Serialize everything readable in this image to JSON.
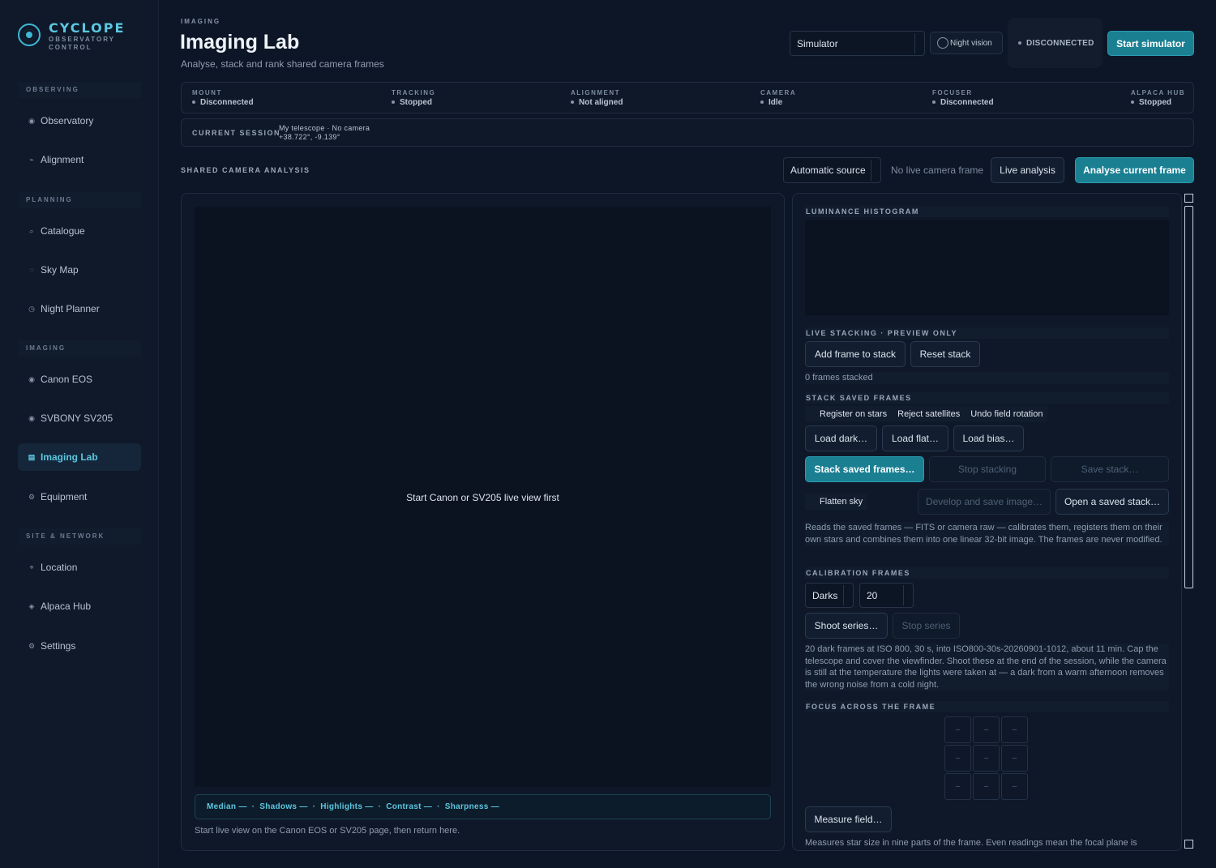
{
  "brand": {
    "name": "CYCLOPE",
    "sub1": "OBSERVATORY",
    "sub2": "CONTROL"
  },
  "sidebar": {
    "sections": [
      {
        "title": "OBSERVING"
      },
      {
        "title": "PLANNING"
      },
      {
        "title": "IMAGING"
      },
      {
        "title": "SITE & NETWORK"
      }
    ],
    "items": [
      {
        "label": "Observatory",
        "icon": "◉"
      },
      {
        "label": "Alignment",
        "icon": "⌁"
      },
      {
        "label": "Catalogue",
        "icon": "⌕"
      },
      {
        "label": "Sky Map",
        "icon": "◌"
      },
      {
        "label": "Night Planner",
        "icon": "◷"
      },
      {
        "label": "Canon EOS",
        "icon": "◉"
      },
      {
        "label": "SVBONY SV205",
        "icon": "◉"
      },
      {
        "label": "Imaging Lab",
        "icon": "▤"
      },
      {
        "label": "Equipment",
        "icon": "⚙"
      },
      {
        "label": "Location",
        "icon": "⌖"
      },
      {
        "label": "Alpaca Hub",
        "icon": "◈"
      },
      {
        "label": "Settings",
        "icon": "⚙"
      }
    ]
  },
  "header": {
    "eyebrow": "IMAGING",
    "title": "Imaging Lab",
    "subtitle": "Analyse, stack and rank shared camera frames",
    "source_select": "Simulator",
    "night_vision": "Night vision",
    "connection": "DISCONNECTED",
    "start_button": "Start simulator"
  },
  "status": [
    {
      "key": "MOUNT",
      "value": "Disconnected"
    },
    {
      "key": "TRACKING",
      "value": "Stopped"
    },
    {
      "key": "ALIGNMENT",
      "value": "Not aligned"
    },
    {
      "key": "CAMERA",
      "value": "Idle"
    },
    {
      "key": "FOCUSER",
      "value": "Disconnected"
    },
    {
      "key": "ALPACA HUB",
      "value": "Stopped"
    }
  ],
  "session": {
    "key": "CURRENT SESSION",
    "line1": "My telescope · No camera",
    "line2": "+38.722°, -9.139°"
  },
  "analysis": {
    "title": "SHARED CAMERA ANALYSIS",
    "source": "Automatic source",
    "no_frame": "No live camera frame",
    "live_button": "Live analysis",
    "analyse_button": "Analyse current frame",
    "viewer_message": "Start Canon or SV205 live view first",
    "stats": {
      "median": "Median —",
      "shadows": "Shadows —",
      "highlights": "Highlights —",
      "contrast": "Contrast —",
      "sharpness": "Sharpness —"
    },
    "hint": "Start live view on the Canon EOS or SV205 page, then return here."
  },
  "right_panel": {
    "histogram_title": "LUMINANCE HISTOGRAM",
    "live_stacking_title": "LIVE STACKING · PREVIEW ONLY",
    "add_frame": "Add frame to stack",
    "reset_stack": "Reset stack",
    "frames_stacked": "0 frames stacked",
    "stack_saved_title": "STACK SAVED FRAMES",
    "options": [
      "Register on stars",
      "Reject satellites",
      "Undo field rotation"
    ],
    "load_dark": "Load dark…",
    "load_flat": "Load flat…",
    "load_bias": "Load bias…",
    "stack_saved_button": "Stack saved frames…",
    "stop_stacking": "Stop stacking",
    "save_stack": "Save stack…",
    "flatten_sky": "Flatten sky",
    "develop_save": "Develop and save image…",
    "open_saved": "Open a saved stack…",
    "stack_description": "Reads the saved frames — FITS or camera raw — calibrates them, registers them on their own stars and combines them into one linear 32-bit image. The frames are never modified.",
    "calibration_title": "CALIBRATION FRAMES",
    "calibration_type": "Darks",
    "calibration_count": "20",
    "shoot_series": "Shoot series…",
    "stop_series": "Stop series",
    "calibration_description": "20 dark frames at ISO 800, 30 s, into ISO800-30s-20260901-1012, about 11 min. Cap the telescope and cover the viewfinder. Shoot these at the end of the session, while the camera is still at the temperature the lights were taken at — a dark from a warm afternoon removes the wrong noise from a cold night.",
    "focus_title": "FOCUS ACROSS THE FRAME",
    "focus_cells": [
      "–",
      "–",
      "–",
      "–",
      "–",
      "–",
      "–",
      "–",
      "–"
    ],
    "measure_field": "Measure field…",
    "measure_description": "Measures star size in nine parts of the frame. Even readings mean the focal plane is"
  }
}
